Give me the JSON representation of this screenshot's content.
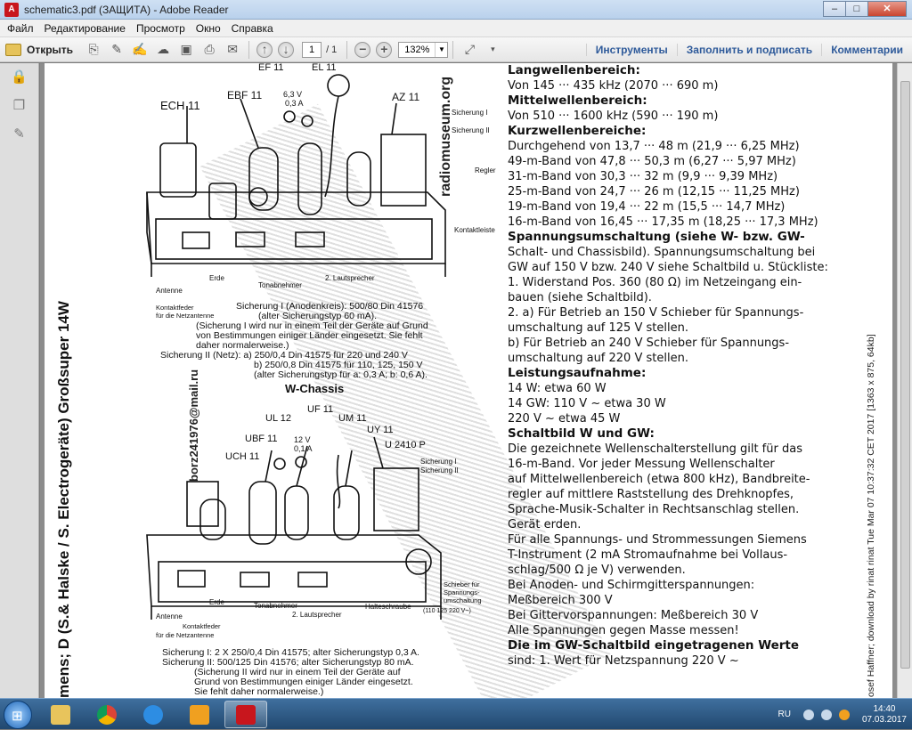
{
  "window": {
    "title": "schematic3.pdf (ЗАЩИТА) - Adobe Reader",
    "app_icon_label": "A",
    "minimize": "–",
    "maximize": "□",
    "close": "✕"
  },
  "menu": [
    "Файл",
    "Редактирование",
    "Просмотр",
    "Окно",
    "Справка"
  ],
  "toolbar": {
    "open_label": "Открыть",
    "page_current": "1",
    "page_total": "/ 1",
    "zoom_value": "132%",
    "tools_label": "Инструменты",
    "fill_sign_label": "Заполнить и подписать",
    "comments_label": "Комментарии"
  },
  "document": {
    "left_vertical": "mens; D (S.& Halske / S. Electrogeräte) Großsuper 14W",
    "mail": "borz241976@mail.ru",
    "museum": "radiomuseum.org",
    "right_vertical": "osef Haffner; download by rinat rinat Tue Mar 07 10:37:32 CET 2017 [1363 x 875, 64kb]",
    "schematic_top": {
      "labels": [
        "EL 11",
        "EF 11",
        "ECH 11",
        "EBF 11",
        "6,3 V",
        "0,3 A",
        "AZ 11",
        "Sicherung I",
        "Sicherung II",
        "Regler",
        "Kontaktleiste",
        "Antenne",
        "Erde",
        "Tonabnehmer",
        "2. Lautsprecher",
        "Kontaktfeder",
        "für die Netzantenne"
      ],
      "notes": [
        "Sicherung I (Anodenkreis): 500/80 Din 41576",
        "(alter Sicherungstyp 60 mA).",
        "(Sicherung I wird nur in einem Teil der Geräte auf Grund",
        "von Bestimmungen einiger Länder eingesetzt. Sie fehlt",
        "daher normalerweise.)",
        "Sicherung II (Netz): a) 250/0,4 Din 41575 für 220 und 240 V",
        "b) 250/0,8 Din 41575 für 110, 125, 150 V",
        "(alter Sicherungstyp für a: 0,3 A; b: 0,6 A)."
      ]
    },
    "w_chassis_title": "W-Chassis",
    "schematic_bottom": {
      "labels": [
        "UF 11",
        "UL 12",
        "UM 11",
        "UY 11",
        "U 2410 P",
        "UBF 11",
        "12 V",
        "0,1 A",
        "UCH 11",
        "Sicherung I",
        "Sicherung II",
        "Erde",
        "Tonabnehmer",
        "2. Lautsprecher",
        "Halteschraube",
        "Schieber für",
        "Spannungs-",
        "umschaltung",
        "(110 125 220 V~)",
        "Antenne",
        "Kontaktfeder",
        "für die Netzantenne"
      ],
      "notes": [
        "Sicherung I: 2 X 250/0,4 Din 41575; alter Sicherungstyp 0,3 A.",
        "Sicherung II: 500/125 Din 41576; alter Sicherungstyp 80 mA.",
        "(Sicherung II wird nur in einem Teil der Geräte auf",
        "Grund von Bestimmungen einiger Länder eingesetzt.",
        "Sie fehlt daher normalerweise.)"
      ]
    },
    "right_text": [
      {
        "t": "Langwellenbereich:",
        "h": true
      },
      {
        "t": "Von 145 ··· 435 kHz (2070 ··· 690 m)",
        "h": false
      },
      {
        "t": "Mittelwellenbereich:",
        "h": true
      },
      {
        "t": "Von 510 ··· 1600 kHz (590 ··· 190 m)",
        "h": false
      },
      {
        "t": "Kurzwellenbereiche:",
        "h": true
      },
      {
        "t": "Durchgehend von 13,7 ··· 48 m (21,9 ··· 6,25 MHz)",
        "h": false
      },
      {
        "t": "49-m-Band von 47,8 ··· 50,3 m (6,27 ··· 5,97 MHz)",
        "h": false
      },
      {
        "t": "31-m-Band von 30,3 ··· 32 m (9,9 ··· 9,39 MHz)",
        "h": false
      },
      {
        "t": "25-m-Band von 24,7 ··· 26 m (12,15 ··· 11,25 MHz)",
        "h": false
      },
      {
        "t": "19-m-Band von 19,4 ··· 22 m (15,5 ··· 14,7 MHz)",
        "h": false
      },
      {
        "t": "16-m-Band von 16,45 ··· 17,35 m (18,25 ··· 17,3 MHz)",
        "h": false
      },
      {
        "t": "Spannungsumschaltung  (siehe W- bzw. GW-",
        "h": true
      },
      {
        "t": "Schalt- und Chassisbild). Spannungsumschaltung bei",
        "h": false
      },
      {
        "t": "GW auf 150 V bzw. 240 V siehe Schaltbild u. Stückliste:",
        "h": false
      },
      {
        "t": "1. Widerstand Pos. 360 (80 Ω) im Netzeingang ein-",
        "h": false
      },
      {
        "t": "    bauen (siehe Schaltbild).",
        "h": false
      },
      {
        "t": "2. a) Für Betrieb an 150 V Schieber für Spannungs-",
        "h": false
      },
      {
        "t": "        umschaltung auf 125 V stellen.",
        "h": false
      },
      {
        "t": "    b) Für Betrieb an 240 V Schieber für Spannungs-",
        "h": false
      },
      {
        "t": "        umschaltung auf 220 V stellen.",
        "h": false
      },
      {
        "t": "Leistungsaufnahme:",
        "h": true
      },
      {
        "t": "14 W: etwa 60 W",
        "h": false
      },
      {
        "t": "14 GW: 110 V ~  etwa 30 W",
        "h": false
      },
      {
        "t": "             220 V ~  etwa 45 W",
        "h": false
      },
      {
        "t": "Schaltbild W und GW:",
        "h": true
      },
      {
        "t": "Die gezeichnete Wellenschalterstellung gilt für das",
        "h": false
      },
      {
        "t": "16-m-Band. Vor jeder Messung Wellenschalter",
        "h": false
      },
      {
        "t": "auf Mittelwellenbereich (etwa 800 kHz), Bandbreite-",
        "h": false
      },
      {
        "t": "regler auf mittlere Raststellung des Drehknopfes,",
        "h": false
      },
      {
        "t": "Sprache-Musik-Schalter in Rechtsanschlag stellen.",
        "h": false
      },
      {
        "t": "Gerät erden.",
        "h": false
      },
      {
        "t": "Für alle Spannungs- und Strommessungen Siemens",
        "h": false
      },
      {
        "t": "T-Instrument (2 mA Stromaufnahme bei Vollaus-",
        "h": false
      },
      {
        "t": "schlag/500 Ω je V) verwenden.",
        "h": false
      },
      {
        "t": "Bei Anoden- und Schirmgitterspannungen:",
        "h": false
      },
      {
        "t": "                              Meßbereich 300 V",
        "h": false
      },
      {
        "t": "Bei Gittervorspannungen: Meßbereich 30 V",
        "h": false
      },
      {
        "t": "Alle Spannungen gegen Masse messen!",
        "h": false
      },
      {
        "t": "Die im GW-Schaltbild eingetragenen Werte",
        "h": true
      },
      {
        "t": "sind: 1. Wert für Netzspannung 220 V ~",
        "h": false
      }
    ]
  },
  "taskbar": {
    "language": "RU",
    "time": "14:40",
    "date": "07.03.2017"
  }
}
